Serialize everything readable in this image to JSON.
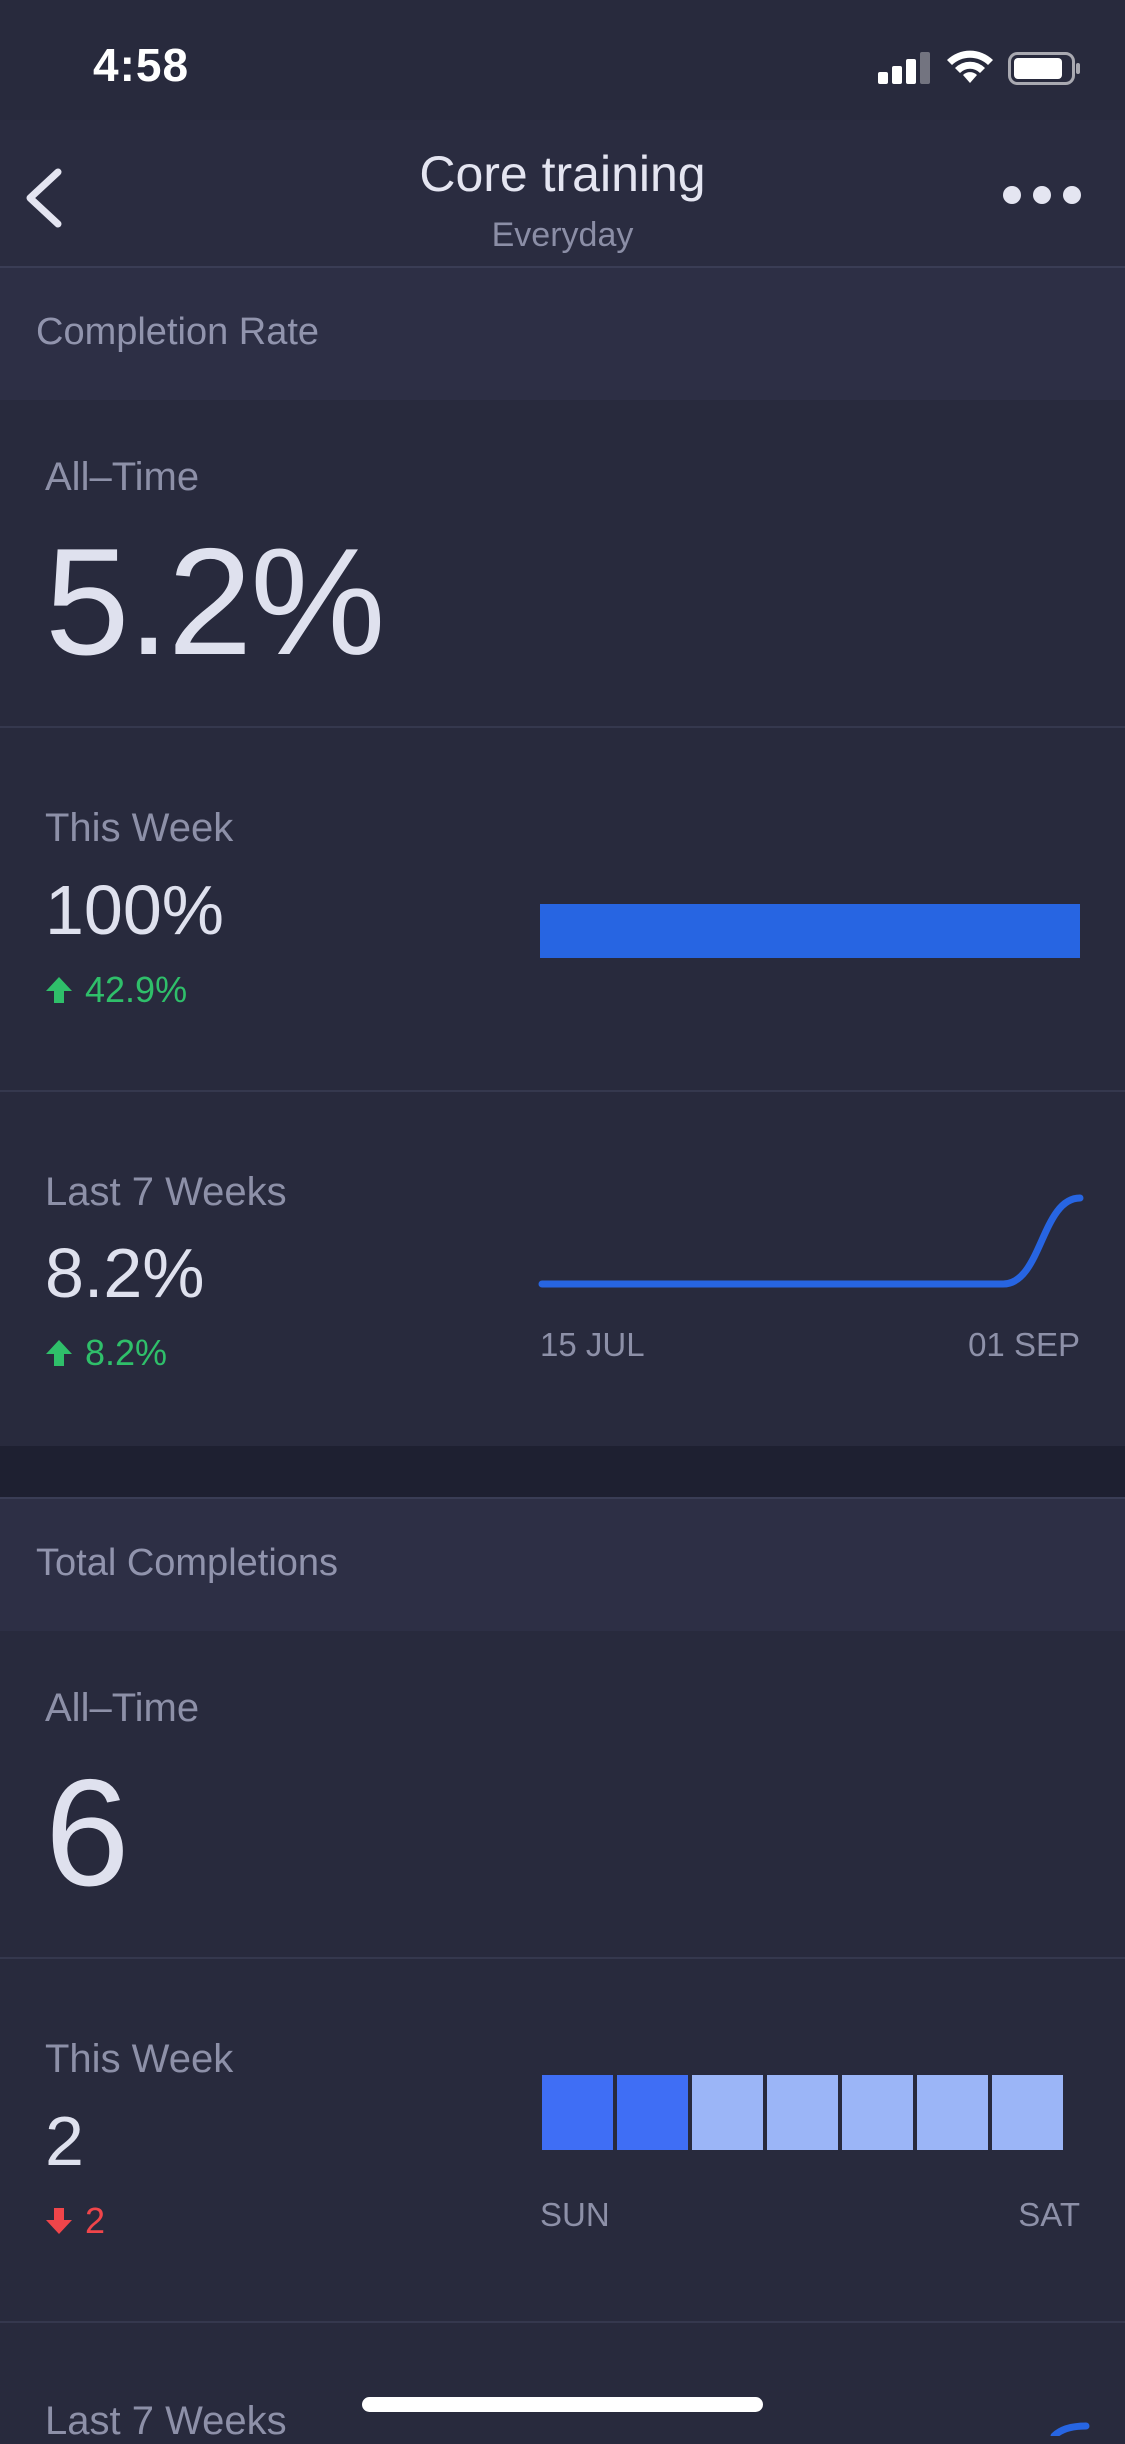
{
  "status_bar": {
    "time": "4:58"
  },
  "header": {
    "title": "Core training",
    "subtitle": "Everyday"
  },
  "completion_rate": {
    "section_title": "Completion Rate",
    "all_time": {
      "label": "All–Time",
      "value": "5.2%"
    },
    "this_week": {
      "label": "This Week",
      "value": "100%",
      "change": "42.9%",
      "direction": "up",
      "bar_fill": 1.0
    },
    "last_7_weeks": {
      "label": "Last 7 Weeks",
      "value": "8.2%",
      "change": "8.2%",
      "direction": "up",
      "axis_start": "15 JUL",
      "axis_end": "01 SEP"
    }
  },
  "total_completions": {
    "section_title": "Total Completions",
    "all_time": {
      "label": "All–Time",
      "value": "6"
    },
    "this_week": {
      "label": "This Week",
      "value": "2",
      "change": "2",
      "direction": "down",
      "axis_start": "SUN",
      "axis_end": "SAT"
    },
    "last_7_weeks": {
      "label": "Last 7 Weeks"
    }
  },
  "colors": {
    "accent": "#2765e2",
    "up": "#2fbf6a",
    "down": "#f0454a",
    "cell_done": "#3f6ef5",
    "cell_pending": "#9bb5f7"
  },
  "chart_data": [
    {
      "type": "bar",
      "categories": [
        "This Week"
      ],
      "values": [
        100
      ],
      "ylim": [
        0,
        100
      ]
    },
    {
      "type": "line",
      "x": [
        "15 JUL",
        "22 JUL",
        "29 JUL",
        "05 AUG",
        "12 AUG",
        "19 AUG",
        "26 AUG",
        "01 SEP"
      ],
      "values": [
        0,
        0,
        0,
        0,
        0,
        0,
        0,
        100
      ],
      "xlabel": "",
      "ylabel": ""
    },
    {
      "type": "bar",
      "categories": [
        "SUN",
        "MON",
        "TUE",
        "WED",
        "THU",
        "FRI",
        "SAT"
      ],
      "values": [
        1,
        1,
        0,
        0,
        0,
        0,
        0
      ]
    }
  ]
}
